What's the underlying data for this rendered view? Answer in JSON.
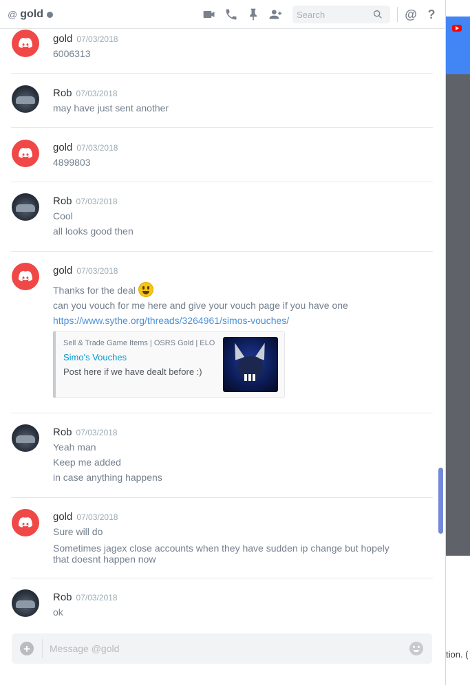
{
  "header": {
    "at_symbol": "@",
    "channel_name": "gold",
    "search_placeholder": "Search",
    "mentions_symbol": "@",
    "help_symbol": "?"
  },
  "messages": [
    {
      "author": "gold",
      "avatar": "discord-logo-icon",
      "timestamp": "07/03/2018",
      "lines": [
        "6006313"
      ]
    },
    {
      "author": "Rob",
      "avatar": "user-photo",
      "timestamp": "07/03/2018",
      "lines": [
        "may have just sent another"
      ]
    },
    {
      "author": "gold",
      "avatar": "discord-logo-icon",
      "timestamp": "07/03/2018",
      "lines": [
        "4899803"
      ]
    },
    {
      "author": "Rob",
      "avatar": "user-photo",
      "timestamp": "07/03/2018",
      "lines": [
        "Cool",
        "all looks good then"
      ]
    },
    {
      "author": "gold",
      "avatar": "discord-logo-icon",
      "timestamp": "07/03/2018",
      "lines": [
        "Thanks for the deal",
        "can you vouch for me here and give your vouch page if you have one"
      ],
      "link": "https://www.sythe.org/threads/3264961/simos-vouches/",
      "embed": {
        "provider": "Sell & Trade Game Items | OSRS Gold | ELO",
        "title": "Simo's Vouches",
        "description": "Post here if we have dealt before :)"
      }
    },
    {
      "author": "Rob",
      "avatar": "user-photo",
      "timestamp": "07/03/2018",
      "lines": [
        "Yeah man",
        "Keep me added",
        "in case anything happens"
      ]
    },
    {
      "author": "gold",
      "avatar": "discord-logo-icon",
      "timestamp": "07/03/2018",
      "lines": [
        "Sure will do",
        "Sometimes jagex close accounts when they have sudden ip change but hopely that doesnt happen now"
      ]
    },
    {
      "author": "Rob",
      "avatar": "user-photo",
      "timestamp": "07/03/2018",
      "lines": [
        "ok"
      ]
    }
  ],
  "composer": {
    "placeholder": "Message @gold"
  },
  "background": {
    "snippet_text": "tion. ("
  },
  "colors": {
    "accent": "#7289da",
    "discord_red": "#f04747",
    "link": "#4a90d9",
    "embed_title": "#0096cf"
  }
}
